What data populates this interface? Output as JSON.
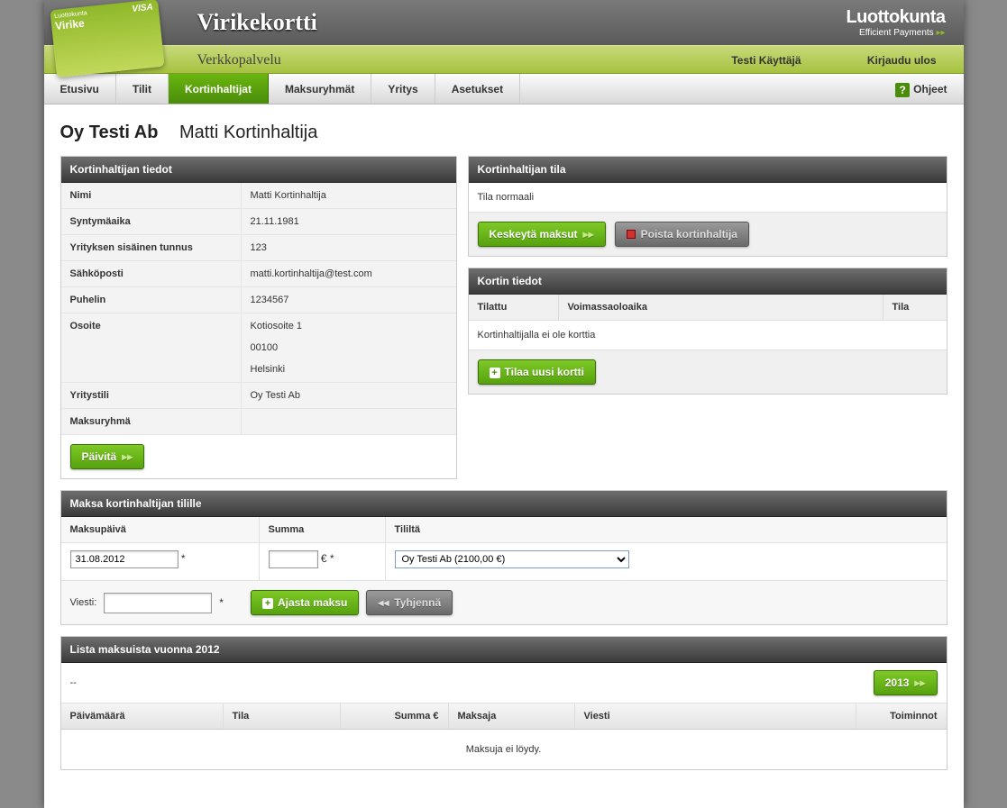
{
  "brand": {
    "title": "Virikekortti",
    "subtitle": "Verkkopalvelu",
    "company": "Luottokunta",
    "tagline": "Efficient Payments",
    "cardLabel": "Virike",
    "cardIssuer": "Luottokunta",
    "cardType": "VISA"
  },
  "userbar": {
    "user": "Testi Käyttäjä",
    "logout": "Kirjaudu ulos"
  },
  "nav": {
    "items": [
      "Etusivu",
      "Tilit",
      "Kortinhaltijat",
      "Maksuryhmät",
      "Yritys",
      "Asetukset"
    ],
    "activeIndex": 2,
    "help": "Ohjeet"
  },
  "breadcrumb": {
    "company": "Oy Testi Ab",
    "person": "Matti Kortinhaltija"
  },
  "holder": {
    "title": "Kortinhaltijan tiedot",
    "rows": [
      {
        "k": "Nimi",
        "v": "Matti Kortinhaltija"
      },
      {
        "k": "Syntymäaika",
        "v": "21.11.1981"
      },
      {
        "k": "Yrityksen sisäinen tunnus",
        "v": "123"
      },
      {
        "k": "Sähköposti",
        "v": "matti.kortinhaltija@test.com"
      },
      {
        "k": "Puhelin",
        "v": "1234567"
      },
      {
        "k": "Osoite",
        "v": "Kotiosoite 1\n\n00100\n\nHelsinki"
      },
      {
        "k": "Yritystili",
        "v": "Oy Testi Ab"
      },
      {
        "k": "Maksuryhmä",
        "v": ""
      }
    ],
    "update": "Päivitä"
  },
  "status": {
    "title": "Kortinhaltijan tila",
    "text": "Tila normaali",
    "suspend": "Keskeytä maksut",
    "remove": "Poista kortinhaltija"
  },
  "card": {
    "title": "Kortin tiedot",
    "colOrdered": "Tilattu",
    "colValid": "Voimassaoloaika",
    "colState": "Tila",
    "empty": "Kortinhaltijalla ei ole korttia",
    "order": "Tilaa uusi kortti"
  },
  "pay": {
    "title": "Maksa kortinhaltijan tilille",
    "colDate": "Maksupäivä",
    "colSum": "Summa",
    "colAcct": "Tililtä",
    "dateValue": "31.08.2012",
    "sumCurrency": "€",
    "acctOption": "Oy Testi Ab (2100,00 €)",
    "msgLabel": "Viesti:",
    "msgValue": "",
    "schedule": "Ajasta maksu",
    "clear": "Tyhjennä",
    "required": "*"
  },
  "list": {
    "title": "Lista maksuista vuonna 2012",
    "prev": "--",
    "next": "2013",
    "cols": {
      "date": "Päivämäärä",
      "state": "Tila",
      "sum": "Summa €",
      "payer": "Maksaja",
      "msg": "Viesti",
      "act": "Toiminnot"
    },
    "empty": "Maksuja ei löydy."
  }
}
